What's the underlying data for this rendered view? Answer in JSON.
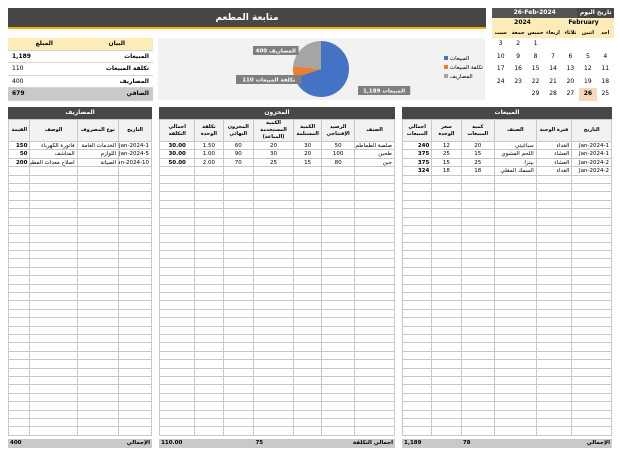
{
  "title": "متابعة المطعم",
  "summary": {
    "header": {
      "label": "البيان",
      "value": "المبلغ"
    },
    "rows": [
      {
        "label": "المبيعات",
        "value": "1,189"
      },
      {
        "label": "تكلفة المبيعات",
        "value": "110"
      },
      {
        "label": "المصاريف",
        "value": "400"
      }
    ],
    "total": {
      "label": "الصافي",
      "value": "679"
    }
  },
  "chart_data": {
    "type": "pie",
    "categories": [
      "المبيعات",
      "تكلفة المبيعات",
      "المصاريف"
    ],
    "values": [
      1189,
      110,
      400
    ],
    "data_labels": [
      "المبيعات 1,189",
      "تكلفة المبيعات 110",
      "المصاريف 400"
    ],
    "colors": [
      "#4472c4",
      "#ed7d31",
      "#a5a5a5"
    ],
    "legend_position": "left"
  },
  "calendar": {
    "today_label": "تاريخ اليوم",
    "today_value": "26-Feb-2024",
    "month": "February",
    "year": "2024",
    "day_names": [
      "احد",
      "اثنين",
      "ثلاثاء",
      "اربعاء",
      "خميس",
      "جمعة",
      "سبت"
    ],
    "weeks": [
      [
        "",
        "",
        "",
        "",
        "1",
        "2",
        "3"
      ],
      [
        "4",
        "5",
        "6",
        "7",
        "8",
        "9",
        "10"
      ],
      [
        "11",
        "12",
        "13",
        "14",
        "15",
        "16",
        "17"
      ],
      [
        "18",
        "19",
        "20",
        "21",
        "22",
        "23",
        "24"
      ],
      [
        "25",
        "26",
        "27",
        "28",
        "29",
        "",
        ""
      ]
    ],
    "today_day": "26"
  },
  "expenses": {
    "title": "المصاريف",
    "columns": [
      "التاريخ",
      "نوع المصروف",
      "الوصف",
      "القيمة"
    ],
    "rows": [
      [
        "1-Jan-2024",
        "الخدمات العامة",
        "فاتورة الكهرباء",
        "150"
      ],
      [
        "5-Jan-2024",
        "اللوازم",
        "المناشف",
        "50"
      ],
      [
        "10-Jan-2024",
        "الصيانة",
        "اصلاح معدات المطبخ",
        "200"
      ]
    ],
    "total_label": "الإجمالي",
    "total_value": "400"
  },
  "inventory": {
    "title": "المخزون",
    "columns": [
      "الصنف",
      "الرصيد الإفتتاحي",
      "الكمية المستلمة",
      "الكمية المستخدمة (المباعة)",
      "المخزون النهائي",
      "تكلفة الوحدة",
      "اجمالي التكلفة"
    ],
    "rows": [
      [
        "صلصة الطماطم",
        "50",
        "30",
        "20",
        "60",
        "1.50",
        "30.00"
      ],
      [
        "طحين",
        "100",
        "20",
        "30",
        "90",
        "1.00",
        "30.00"
      ],
      [
        "جبن",
        "80",
        "15",
        "25",
        "70",
        "2.00",
        "50.00"
      ]
    ],
    "total_label": "اجمالي التكلفة",
    "total_used": "75",
    "total_cost": "110.00"
  },
  "sales": {
    "title": "المبيعات",
    "columns": [
      "التاريخ",
      "فترة الوجبة",
      "الصنف",
      "كمية المبيعات",
      "سعر الوحدة",
      "اجمالي المبيعات"
    ],
    "rows": [
      [
        "1-Jan-2024",
        "الغداء",
        "سباغيتي",
        "20",
        "12",
        "240"
      ],
      [
        "1-Jan-2024",
        "العشاء",
        "اللحم المشوي",
        "15",
        "25",
        "375"
      ],
      [
        "2-Jan-2024",
        "العشاء",
        "بيتزا",
        "25",
        "15",
        "375"
      ],
      [
        "2-Jan-2024",
        "الغداء",
        "السمك المقلي",
        "18",
        "18",
        "324"
      ]
    ],
    "total_label": "الإجمالي",
    "total_qty": "78",
    "total_sales": "1,189"
  }
}
